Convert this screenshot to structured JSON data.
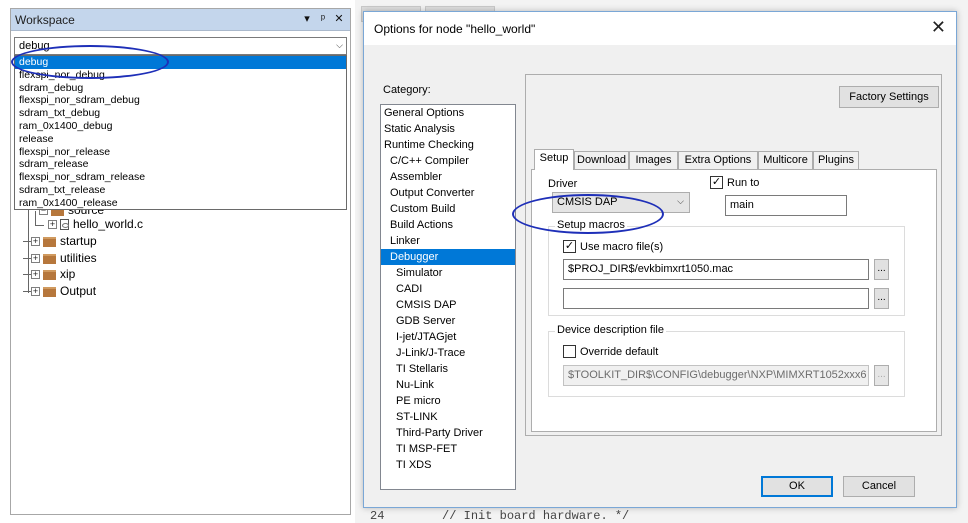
{
  "workspace": {
    "title": "Workspace",
    "controls": [
      "▾",
      "ᵖ",
      "✕"
    ],
    "config_selected": "debug",
    "config_options": [
      "debug",
      "flexspi_nor_debug",
      "sdram_debug",
      "flexspi_nor_sdram_debug",
      "sdram_txt_debug",
      "ram_0x1400_debug",
      "release",
      "flexspi_nor_release",
      "sdram_release",
      "flexspi_nor_sdram_release",
      "sdram_txt_release",
      "ram_0x1400_release"
    ],
    "tree": {
      "partial_folder": "source",
      "file": "hello_world.c",
      "folders": [
        "startup",
        "utilities",
        "xip",
        "Output"
      ]
    }
  },
  "background": {
    "code_line_number": "24",
    "code_text": "// Init board hardware. */"
  },
  "dialog": {
    "title": "Options for node \"hello_world\"",
    "close": "✕",
    "category_label": "Category:",
    "categories": [
      {
        "label": "General Options",
        "level": 0
      },
      {
        "label": "Static Analysis",
        "level": 0
      },
      {
        "label": "Runtime Checking",
        "level": 0
      },
      {
        "label": "C/C++ Compiler",
        "level": 1
      },
      {
        "label": "Assembler",
        "level": 1
      },
      {
        "label": "Output Converter",
        "level": 1
      },
      {
        "label": "Custom Build",
        "level": 1
      },
      {
        "label": "Build Actions",
        "level": 1
      },
      {
        "label": "Linker",
        "level": 1
      },
      {
        "label": "Debugger",
        "level": 1,
        "selected": true
      },
      {
        "label": "Simulator",
        "level": 2
      },
      {
        "label": "CADI",
        "level": 2
      },
      {
        "label": "CMSIS DAP",
        "level": 2
      },
      {
        "label": "GDB Server",
        "level": 2
      },
      {
        "label": "I-jet/JTAGjet",
        "level": 2
      },
      {
        "label": "J-Link/J-Trace",
        "level": 2
      },
      {
        "label": "TI Stellaris",
        "level": 2
      },
      {
        "label": "Nu-Link",
        "level": 2
      },
      {
        "label": "PE micro",
        "level": 2
      },
      {
        "label": "ST-LINK",
        "level": 2
      },
      {
        "label": "Third-Party Driver",
        "level": 2
      },
      {
        "label": "TI MSP-FET",
        "level": 2
      },
      {
        "label": "TI XDS",
        "level": 2
      }
    ],
    "factory_settings": "Factory Settings",
    "tabs": [
      "Setup",
      "Download",
      "Images",
      "Extra Options",
      "Multicore",
      "Plugins"
    ],
    "active_tab": "Setup",
    "setup": {
      "driver_label": "Driver",
      "driver_value": "CMSIS DAP",
      "run_to_label": "Run to",
      "run_to_checked": true,
      "run_to_value": "main",
      "setup_macros_title": "Setup macros",
      "use_macro_label": "Use macro file(s)",
      "use_macro_checked": true,
      "macro_file_1": "$PROJ_DIR$/evkbimxrt1050.mac",
      "macro_file_2": "",
      "browse_label": "...",
      "device_desc_title": "Device description file",
      "override_label": "Override default",
      "override_checked": false,
      "device_desc_value": "$TOOLKIT_DIR$\\CONFIG\\debugger\\NXP\\MIMXRT1052xxx6"
    },
    "ok": "OK",
    "cancel": "Cancel"
  },
  "colors": {
    "selection": "#0078d7",
    "annotation_oval": "#1e2fb8",
    "workspace_title_bg": "#c4d6ec"
  }
}
